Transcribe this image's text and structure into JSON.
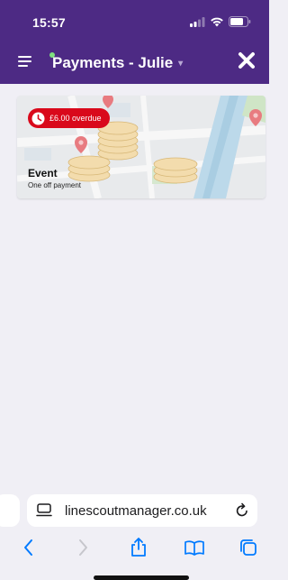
{
  "status_bar": {
    "time": "15:57"
  },
  "header": {
    "title": "Payments - Julie",
    "caret": "▾",
    "background": "#4d2a84",
    "notification_dot_color": "#7fe07f"
  },
  "payment_card": {
    "badge": "£6.00 overdue",
    "badge_color": "#d9091b",
    "title": "Event",
    "subtitle": "One off payment"
  },
  "browser": {
    "url": "linescoutmanager.co.uk",
    "accent_color": "#007aff",
    "toolbar_icons": [
      "back-icon",
      "forward-icon",
      "share-icon",
      "bookmarks-icon",
      "tabs-icon"
    ]
  }
}
